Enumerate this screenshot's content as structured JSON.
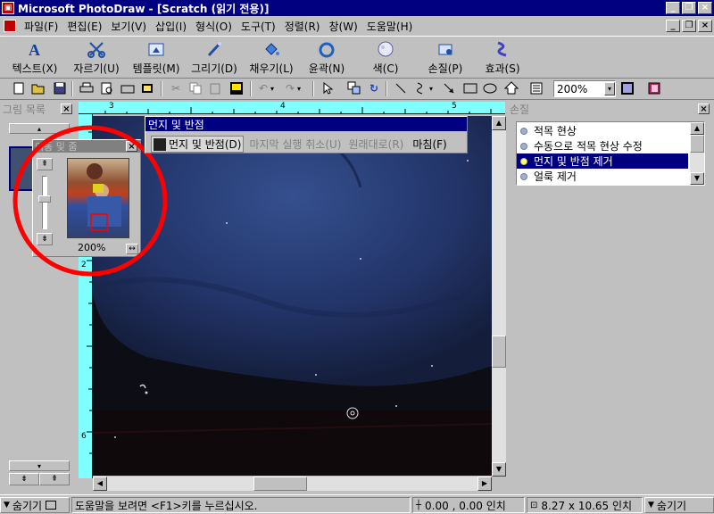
{
  "window": {
    "title": "Microsoft PhotoDraw - [Scratch (읽기 전용)]"
  },
  "menu": [
    "파일(F)",
    "편집(E)",
    "보기(V)",
    "삽입(I)",
    "형식(O)",
    "도구(T)",
    "정렬(R)",
    "창(W)",
    "도움말(H)"
  ],
  "bigtoolbar": [
    {
      "label": "텍스트(X)",
      "icon": "text-icon"
    },
    {
      "label": "자르기(U)",
      "icon": "scissors-icon"
    },
    {
      "label": "템플릿(M)",
      "icon": "template-icon"
    },
    {
      "label": "그리기(D)",
      "icon": "draw-icon"
    },
    {
      "label": "채우기(L)",
      "icon": "fill-icon"
    },
    {
      "label": "윤곽(N)",
      "icon": "outline-icon"
    },
    {
      "label": "색(C)",
      "icon": "color-icon"
    },
    {
      "label": "손질(P)",
      "icon": "touchup-icon"
    },
    {
      "label": "효과(S)",
      "icon": "effects-icon"
    }
  ],
  "zoom": "200%",
  "picture_list": {
    "title": "그림 목록"
  },
  "pan_zoom": {
    "title": "이동 및 줌",
    "zoom_label": "200%"
  },
  "dust_toolbar": {
    "title": "먼지 및 반점",
    "tool_label": "먼지 및 반점(D)",
    "undo_label": "마지막 실행 취소(U)",
    "revert_label": "원래대로(R)",
    "finish_label": "마침(F)"
  },
  "touchup_panel": {
    "title": "손질",
    "items": [
      {
        "label": "적목 현상",
        "selected": false
      },
      {
        "label": "수동으로 적목 현상 수정",
        "selected": false
      },
      {
        "label": "먼지 및 반점 제거",
        "selected": true
      },
      {
        "label": "얼룩 제거",
        "selected": false
      }
    ]
  },
  "ruler": {
    "h_ticks": [
      "3",
      "4",
      "5"
    ],
    "v_ticks": [
      "2",
      "6"
    ]
  },
  "status": {
    "hide_left": "숨기기",
    "help_text": "도움말을 보려면 <F1>키를 누르십시오.",
    "position": "0.00 , 0.00 인치",
    "size": "8.27 x 10.65 인치",
    "hide_right": "숨기기"
  },
  "colors": {
    "title_bar": "#000080",
    "ruler": "#80ffff",
    "highlight_circle": "#ff0000",
    "selection": "#000080"
  }
}
